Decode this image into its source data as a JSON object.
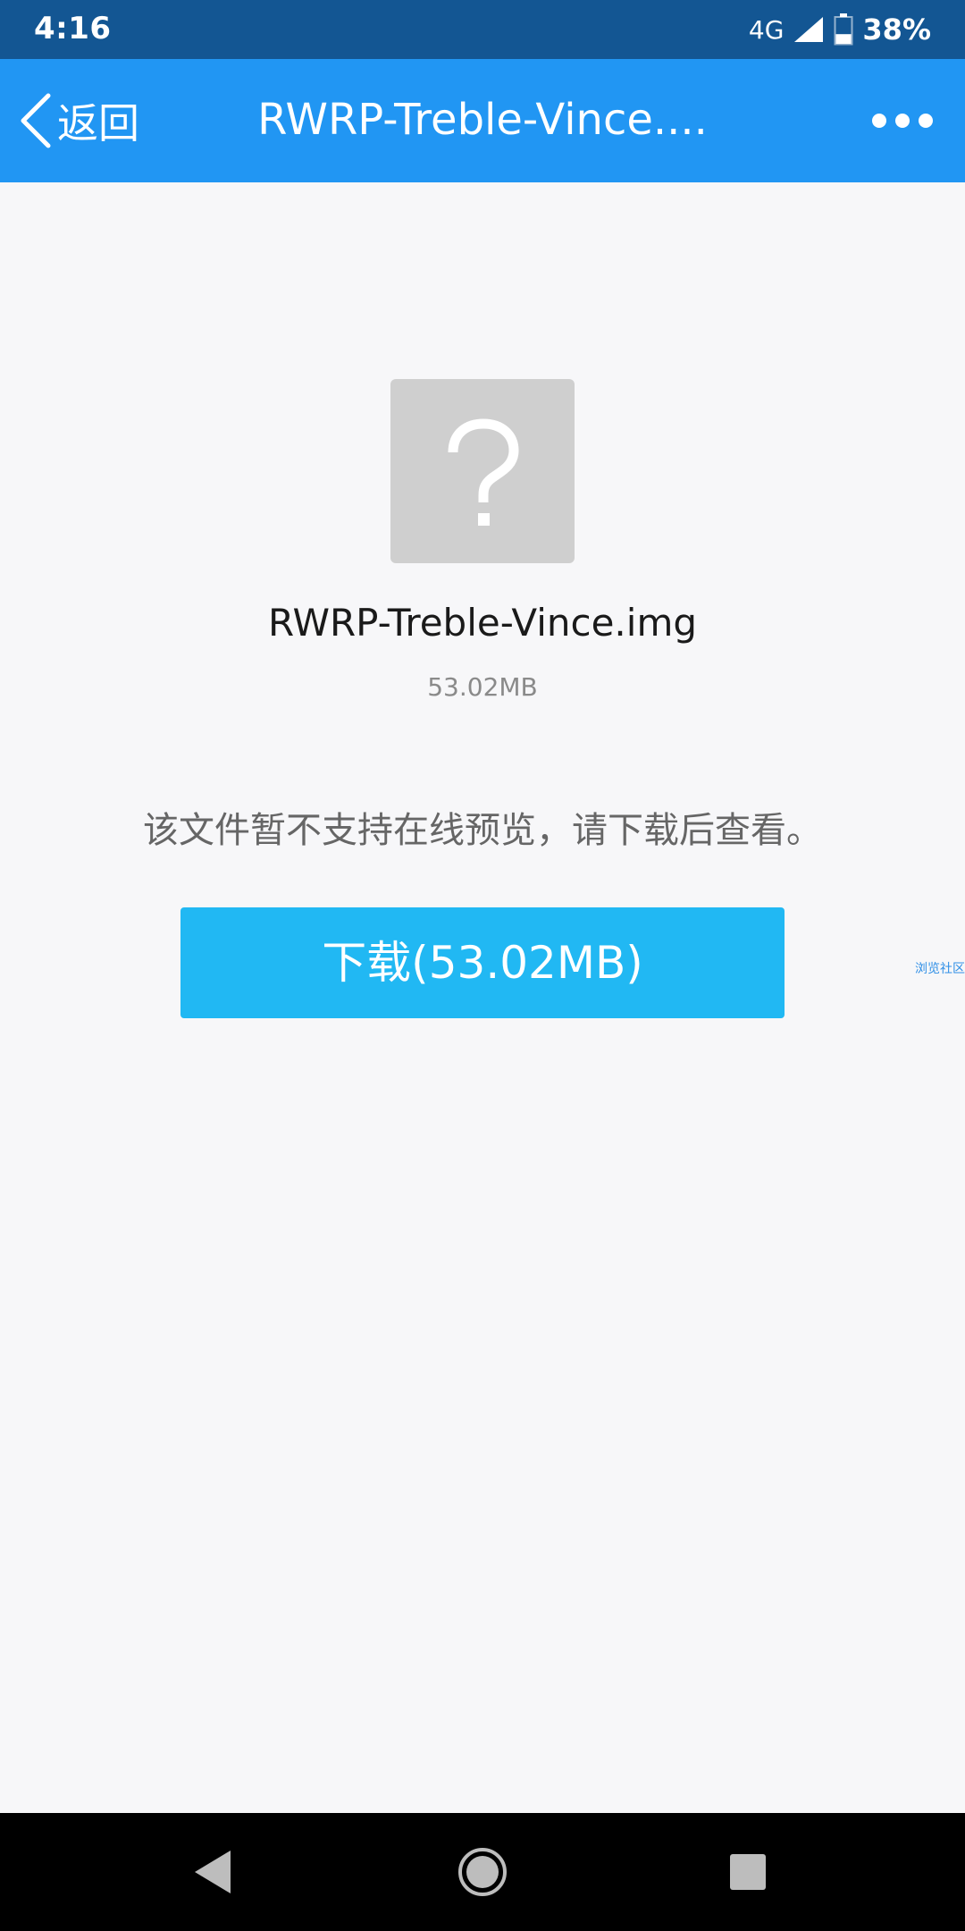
{
  "status_bar": {
    "time": "4:16",
    "network": "4G",
    "battery": "38%",
    "battery_level": 0.38
  },
  "nav": {
    "back_label": "返回",
    "title": "RWRP-Treble-Vince...."
  },
  "file": {
    "icon": "question-mark-icon",
    "name": "RWRP-Treble-Vince.img",
    "size": "53.02MB"
  },
  "notice": "该文件暂不支持在线预览，请下载后查看。",
  "download_button": "下载(53.02MB)",
  "watermark": "浏览社区",
  "colors": {
    "status_bar": "#135693",
    "nav_bar": "#2196f3",
    "download_button": "#21b8f3",
    "background": "#f7f7f9",
    "file_icon_bg": "#cfcfcf"
  }
}
